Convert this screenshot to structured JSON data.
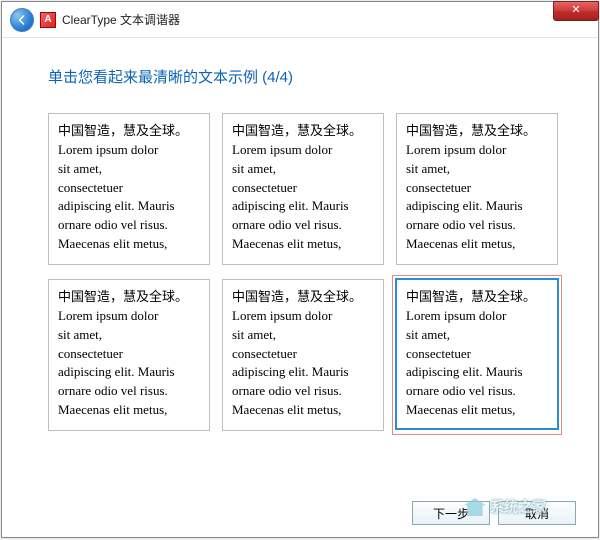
{
  "titlebar": {
    "close_glyph": "✕"
  },
  "header": {
    "app_icon_letter": "A",
    "title": "ClearType 文本调谐器"
  },
  "heading": "单击您看起来最清晰的文本示例 (4/4)",
  "sample_text": {
    "line_cn": "中国智造，慧及全球。",
    "line1": "Lorem ipsum dolor",
    "line2": "sit amet,",
    "line3": "consectetuer",
    "line4": "adipiscing elit. Mauris",
    "line5": "ornare odio vel risus.",
    "line6": "Maecenas elit metus,"
  },
  "selected_index": 5,
  "buttons": {
    "next": "下一步",
    "cancel": "取消"
  },
  "watermark_text": "系统之家"
}
